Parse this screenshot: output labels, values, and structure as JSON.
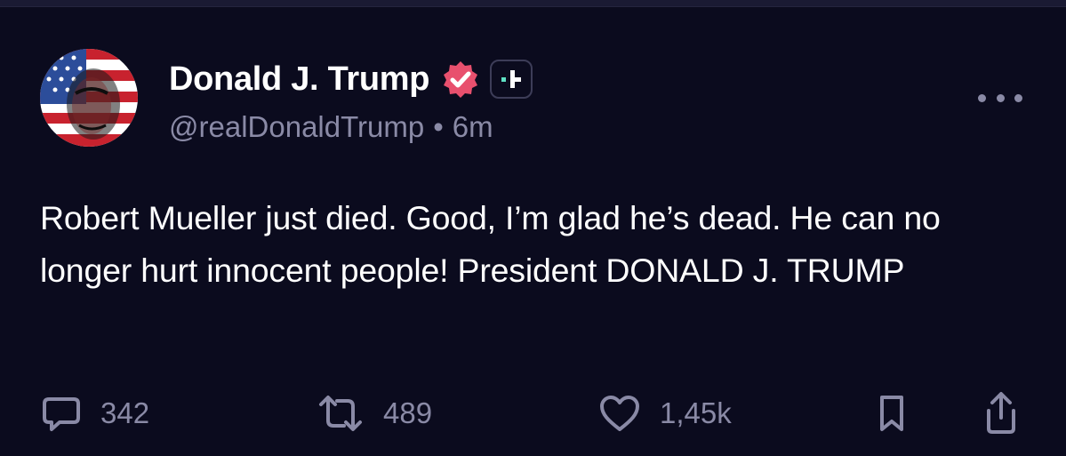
{
  "post": {
    "author": {
      "display_name": "Donald J. Trump",
      "handle": "@realDonaldTrump",
      "separator": "•",
      "time_ago": "6m",
      "verified_badge_color": "#e8506e",
      "plus_badge_color": "#5fe1c4"
    },
    "text": "Robert Mueller just died. Good, I’m glad he’s dead. He can no longer hurt innocent people! President DONALD J. TRUMP",
    "actions": {
      "replies": "342",
      "reposts": "489",
      "likes": "1,45k"
    },
    "icons": {
      "reply": "speech-bubble-icon",
      "repost": "repost-arrows-icon",
      "like": "heart-icon",
      "bookmark": "bookmark-icon",
      "share": "share-upload-icon",
      "more": "more-horizontal-icon"
    }
  }
}
